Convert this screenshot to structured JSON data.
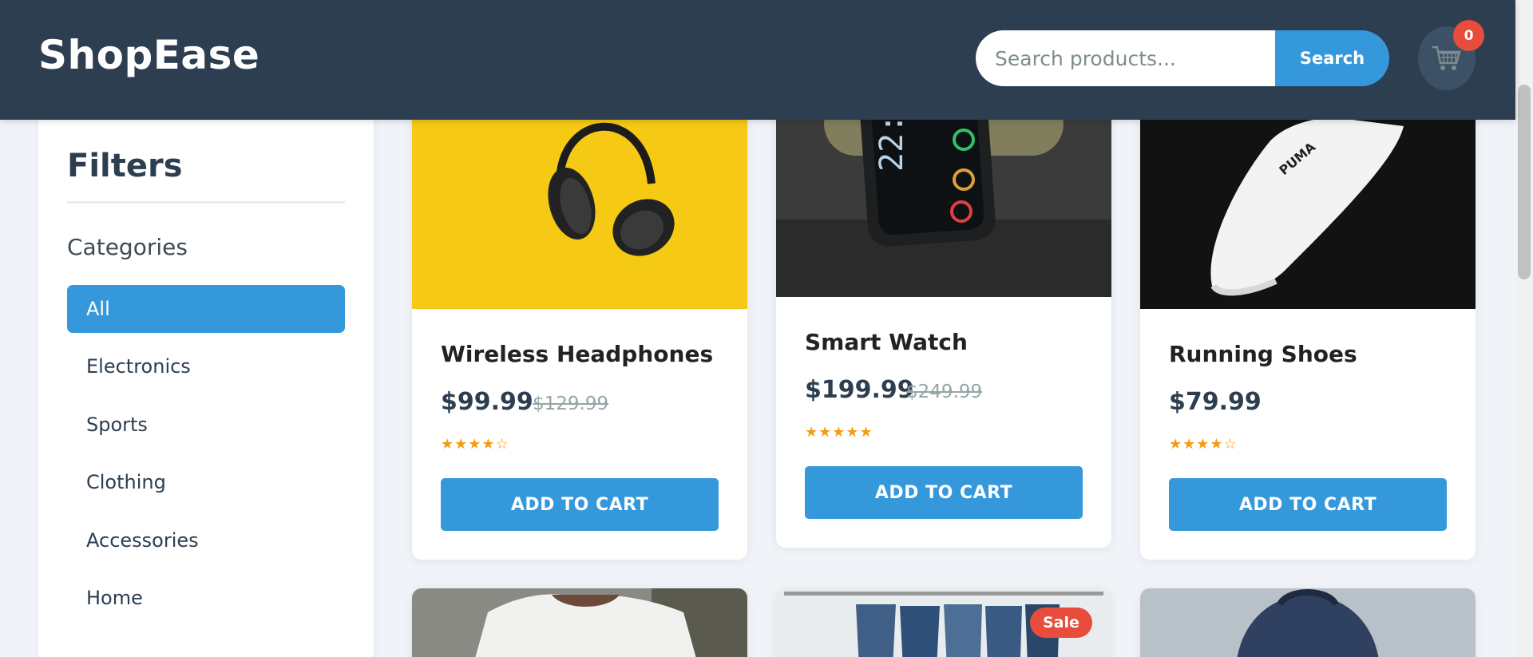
{
  "brand": {
    "name": "ShopEase"
  },
  "search": {
    "placeholder": "Search products...",
    "button_label": "Search"
  },
  "cart": {
    "count": "0",
    "icon": "cart-icon"
  },
  "sidebar": {
    "title": "Filters",
    "categories_title": "Categories",
    "categories": [
      {
        "label": "All",
        "active": true
      },
      {
        "label": "Electronics",
        "active": false
      },
      {
        "label": "Sports",
        "active": false
      },
      {
        "label": "Clothing",
        "active": false
      },
      {
        "label": "Accessories",
        "active": false
      },
      {
        "label": "Home",
        "active": false
      }
    ]
  },
  "products": [
    {
      "name": "Wireless Headphones",
      "price": "$99.99",
      "old_price": "$129.99",
      "rating": 4,
      "stars": "★★★★☆",
      "button_label": "ADD TO CART",
      "image": "headphones-image"
    },
    {
      "name": "Smart Watch",
      "price": "$199.99",
      "old_price": "$249.99",
      "rating": 5,
      "stars": "★★★★★",
      "button_label": "ADD TO CART",
      "image": "smartwatch-image"
    },
    {
      "name": "Running Shoes",
      "price": "$79.99",
      "old_price": "",
      "rating": 4,
      "stars": "★★★★☆",
      "button_label": "ADD TO CART",
      "image": "shoes-image"
    },
    {
      "image": "tshirt-image"
    },
    {
      "image": "jeans-image",
      "badge": "Sale"
    },
    {
      "image": "backpack-image"
    }
  ],
  "colors": {
    "header": "#2c3e50",
    "accent": "#3498db",
    "badge": "#e74c3c",
    "star": "#f39c12"
  }
}
